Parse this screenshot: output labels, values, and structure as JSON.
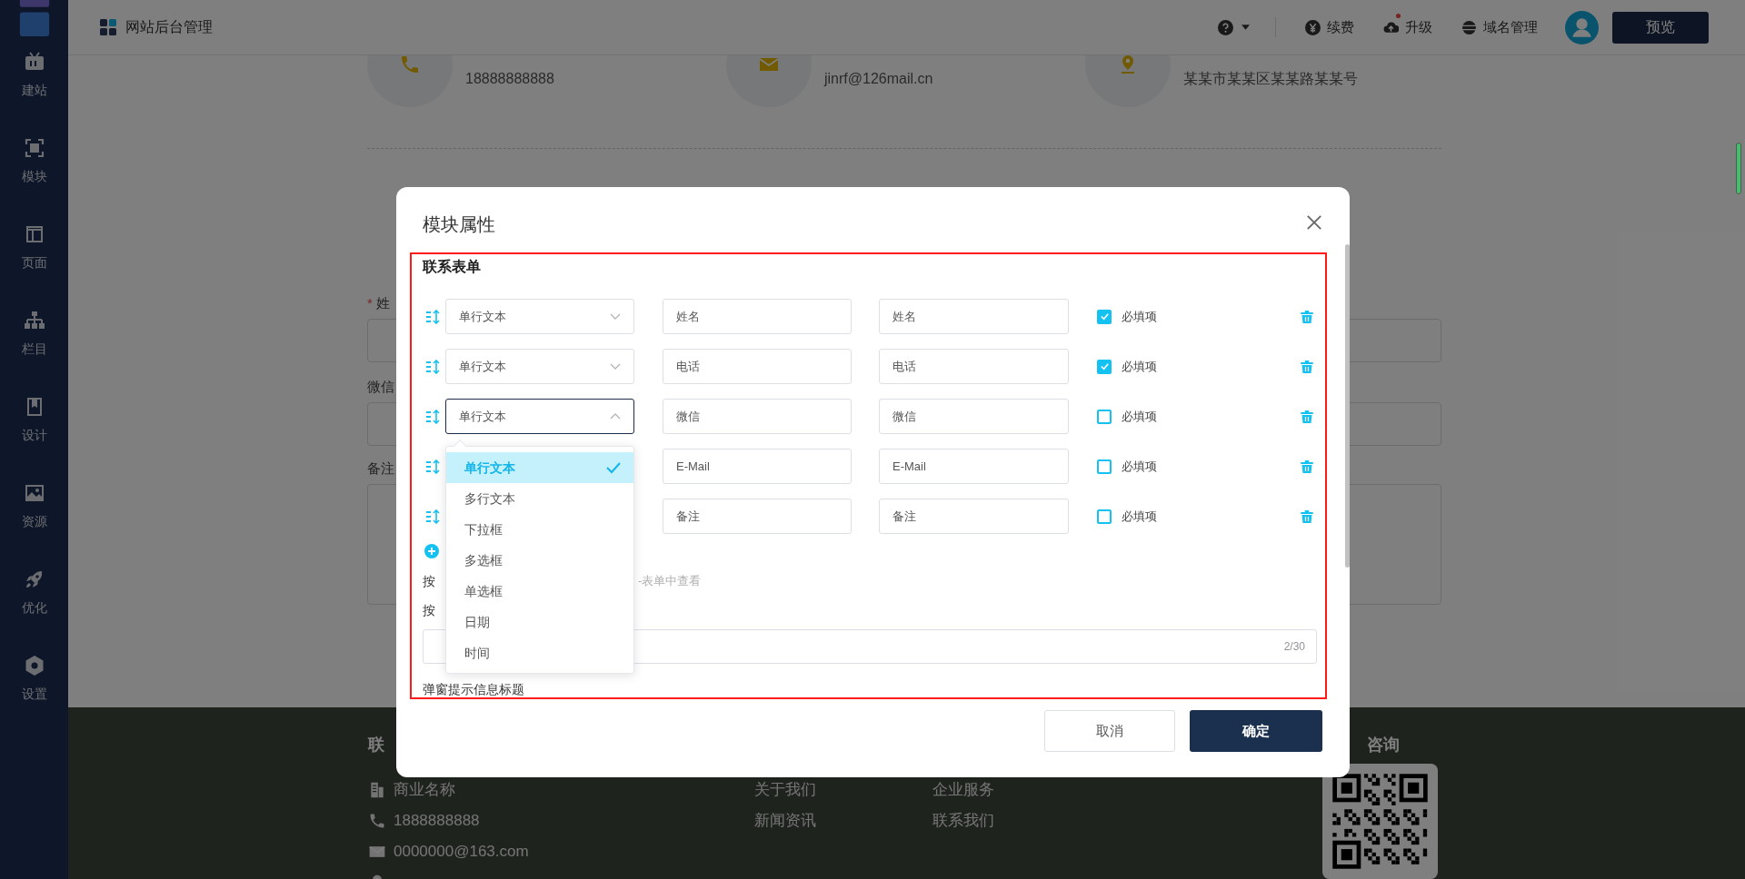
{
  "sidebar": {
    "items": [
      {
        "kind": "tv",
        "label": "建站"
      },
      {
        "kind": "frame",
        "label": "模块"
      },
      {
        "kind": "layout",
        "label": "页面"
      },
      {
        "kind": "sitemap",
        "label": "栏目"
      },
      {
        "kind": "bookmark",
        "label": "设计"
      },
      {
        "kind": "image",
        "label": "资源"
      },
      {
        "kind": "rocket",
        "label": "优化"
      },
      {
        "kind": "settings",
        "label": "设置"
      }
    ]
  },
  "topbar": {
    "title": "网站后台管理",
    "actions": [
      {
        "kind": "help",
        "badge": false
      },
      {
        "kind": "renew",
        "label": "续费",
        "badge": false
      },
      {
        "kind": "upgrade",
        "label": "升级",
        "badge": true
      },
      {
        "kind": "domain",
        "label": "域名管理",
        "badge": false
      }
    ],
    "preview_button": "预览"
  },
  "page": {
    "contacts": [
      {
        "kind": "phone",
        "text": "18888888888"
      },
      {
        "kind": "mail",
        "text": "jinrf@126mail.cn"
      },
      {
        "kind": "location",
        "text": "某某市某某区某某路某某号"
      }
    ],
    "form_fields": [
      {
        "label": "姓",
        "required_mark": "*",
        "kind": "input"
      },
      {
        "label": "微信",
        "kind": "input"
      },
      {
        "label": "备注",
        "kind": "textarea"
      }
    ]
  },
  "footer": {
    "contact_heading": "联",
    "contact_items": [
      {
        "kind": "building",
        "text": "商业名称"
      },
      {
        "kind": "phone",
        "text": "1888888888"
      },
      {
        "kind": "mail",
        "text": "0000000@163.com"
      },
      {
        "kind": "location"
      }
    ],
    "link_columns": [
      [
        "关于我们",
        "新闻资讯"
      ],
      [
        "企业服务",
        "联系我们"
      ]
    ],
    "qr_heading": "咨询"
  },
  "modal": {
    "title": "模块属性",
    "section_title": "联系表单",
    "rows": [
      {
        "type": "单行文本",
        "open": false,
        "values": [
          "姓名",
          "姓名"
        ],
        "required": true,
        "required_label": "必填项"
      },
      {
        "type": "单行文本",
        "open": false,
        "values": [
          "电话",
          "电话"
        ],
        "required": true,
        "required_label": "必填项"
      },
      {
        "type": "单行文本",
        "open": true,
        "values": [
          "微信",
          "微信"
        ],
        "required": false,
        "required_label": "必填项"
      },
      {
        "values": [
          "E-Mail",
          "E-Mail"
        ],
        "required": false,
        "required_label": "必填项"
      },
      {
        "values": [
          "备注",
          "备注"
        ],
        "required": false,
        "required_label": "必填项"
      }
    ],
    "dropdown": {
      "options": [
        {
          "label": "单行文本",
          "selected": true
        },
        {
          "label": "多行文本",
          "selected": false
        },
        {
          "label": "下拉框",
          "selected": false
        },
        {
          "label": "多选框",
          "selected": false
        },
        {
          "label": "单选框",
          "selected": false
        },
        {
          "label": "日期",
          "selected": false
        },
        {
          "label": "时间",
          "selected": false
        }
      ]
    },
    "button_section_label": "按",
    "button_hint": "-表单中查看",
    "button_text_label": "按",
    "button_text_counter": "2/30",
    "popup_title_label": "弹窗提示信息标题",
    "cancel_button": "取消",
    "confirm_button": "确定"
  }
}
